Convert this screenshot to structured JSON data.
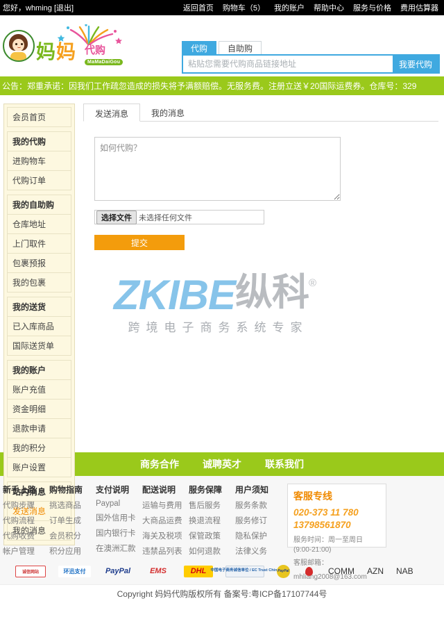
{
  "topbar": {
    "greeting": "您好，whming [退出]",
    "nav": [
      "返回首页",
      "购物车（5）",
      "我的账户",
      "帮助中心",
      "服务与价格",
      "费用估算器"
    ]
  },
  "logo": {
    "brand_cn_1": "妈",
    "brand_cn_2": "妈",
    "brand_suffix": "代购",
    "pinyin": "MaMaDaiGou"
  },
  "search": {
    "tabs": [
      {
        "label": "代购",
        "active": true
      },
      {
        "label": "自助购",
        "active": false
      }
    ],
    "placeholder": "粘贴您需要代购商品链接地址",
    "value": "",
    "button_label": "我要代购",
    "accent_color": "#3fa9e0"
  },
  "announcement": {
    "text": "公告：郑重承诺：因我们工作疏忽造成的损失将予满额赔偿。无服务费。注册立送￥20国际运费券。仓库号：329",
    "background": "#9ac91b"
  },
  "sidebar": {
    "home_label": "会员首页",
    "groups": [
      {
        "head": "我的代购",
        "items": [
          "进购物车",
          "代购订单"
        ]
      },
      {
        "head": "我的自助购",
        "items": [
          "仓库地址",
          "上门取件",
          "包裹预报",
          "我的包裹"
        ]
      },
      {
        "head": "我的送货",
        "items": [
          "已入库商品",
          "国际送货单"
        ]
      },
      {
        "head": "我的账户",
        "items": [
          "账户充值",
          "资金明细",
          "退款申请",
          "我的积分",
          "账户设置"
        ]
      },
      {
        "head": "站内消息",
        "items": [
          "发送消息",
          "我的消息"
        ]
      }
    ],
    "active_item": "发送消息",
    "active_color": "#f08a00"
  },
  "main": {
    "tabs": [
      {
        "label": "发送消息",
        "active": true
      },
      {
        "label": "我的消息",
        "active": false
      }
    ],
    "message_placeholder": "如何代购？",
    "message_value": "",
    "file_button_label": "选择文件",
    "file_status": "未选择任何文件",
    "submit_label": "提交",
    "submit_color": "#f39c0c"
  },
  "watermark": {
    "latin": "ZKIBE",
    "cjk": "纵科",
    "registered": "®",
    "tagline": "跨境电子商务系统专家",
    "latin_color": "#87c4ea",
    "cjk_color": "#b9bcc0"
  },
  "footer_nav": [
    "商务合作",
    "诚聘英才",
    "联系我们"
  ],
  "footer_columns": [
    {
      "title": "新手上路",
      "links": [
        "代购步骤",
        "代购流程",
        "代购收费",
        "帐户管理"
      ]
    },
    {
      "title": "购物指南",
      "links": [
        "挑选商品",
        "订单生成",
        "会员积分",
        "积分应用"
      ]
    },
    {
      "title": "支付说明",
      "links": [
        "Paypal",
        "国外信用卡",
        "国内银行卡",
        "在澳洲汇款"
      ]
    },
    {
      "title": "配送说明",
      "links": [
        "运输与费用",
        "大商品运费",
        "海关及税项",
        "违禁品列表"
      ]
    },
    {
      "title": "服务保障",
      "links": [
        "售后服务",
        "换退流程",
        "保管政策",
        "如何退款"
      ]
    },
    {
      "title": "用户须知",
      "links": [
        "服务条款",
        "服务修订",
        "隐私保护",
        "法律义务"
      ]
    }
  ],
  "service_box": {
    "title": "客服专线",
    "phone1": "020-373 11 780",
    "phone2": "13798561870",
    "hours": "服务时间：周一至周日(9:00-21:00)",
    "email_label": "客服邮箱：",
    "email": "mhliang2008@163.com",
    "title_color": "#f08a00"
  },
  "partner_logos": [
    {
      "name": "credit-trust-badge",
      "text": "诚信网站",
      "kind": "trust"
    },
    {
      "name": "huanxun-pay-logo",
      "text": "环迅支付",
      "kind": "huanxun"
    },
    {
      "name": "paypal-logo",
      "text": "PayPal",
      "kind": "paypal"
    },
    {
      "name": "ems-logo",
      "text": "EMS",
      "kind": "ems"
    },
    {
      "name": "dhl-logo",
      "text": "DHL",
      "kind": "dhl"
    },
    {
      "name": "ec-trust-china-logo",
      "text": "中国电子商务诚信单位 / EC Trust China",
      "kind": "ectrust"
    },
    {
      "name": "paypal-seal-logo",
      "text": "PayPal",
      "kind": "paypalgold"
    },
    {
      "name": "shanghai-industry-commerce-badge",
      "text": "上海工商",
      "kind": "shanghai"
    },
    {
      "name": "comm-bank-logo",
      "text": "COMM",
      "kind": "text"
    },
    {
      "name": "azn-bank-logo",
      "text": "AZN",
      "kind": "text"
    },
    {
      "name": "nab-bank-logo",
      "text": "NAB",
      "kind": "text"
    }
  ],
  "copyright": "Copyright 妈妈代购版权所有 备案号:粤ICP备17107744号"
}
